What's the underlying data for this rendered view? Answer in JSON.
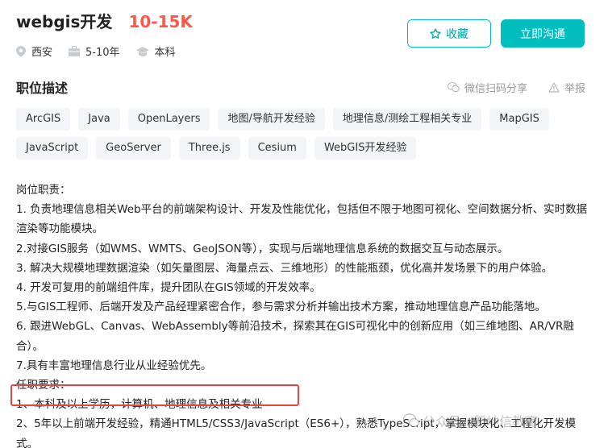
{
  "job": {
    "title": "webgis开发",
    "salary": "10-15K",
    "location": "西安",
    "experience": "5-10年",
    "degree": "本科"
  },
  "actions": {
    "collect_label": "收藏",
    "chat_label": "立即沟通"
  },
  "section": {
    "title": "职位描述",
    "share_label": "微信扫码分享",
    "report_label": "举报"
  },
  "tags": {
    "row1": [
      "ArcGIS",
      "Java",
      "OpenLayers",
      "地图/导航开发经验",
      "地理信息/测绘工程相关专业",
      "MapGIS"
    ],
    "row2": [
      "JavaScript",
      "GeoServer",
      "Three.js",
      "Cesium",
      "WebGIS开发经验"
    ]
  },
  "description": {
    "lines": [
      "岗位职责：",
      "1. 负责地理信息相关Web平台的前端架构设计、开发及性能优化，包括但不限于地图可视化、空间数据分析、实时数据渲染等功能模块。",
      "2.对接GIS服务（如WMS、WMTS、GeoJSON等），实现与后端地理信息系统的数据交互与动态展示。",
      "3. 解决大规模地理数据渲染（如矢量图层、海量点云、三维地形）的性能瓶颈，优化高并发场景下的用户体验。",
      "4. 开发可复用的前端组件库，提升团队在GIS领域的开发效率。",
      "5.与GIS工程师、后端开发及产品经理紧密合作，参与需求分析并输出技术方案，推动地理信息产品功能落地。",
      "6. 跟进WebGL、Canvas、WebAssembly等前沿技术，探索其在GIS可视化中的创新应用（如三维地图、AR/VR融合）。",
      "7.具有丰富地理信息行业从业经验优先。",
      "任职要求：",
      "1、本科及以上学历，计算机、地理信息及相关专业",
      "2、5年以上前端开发经验，精通HTML5/CSS3/JavaScript（ES6+），熟悉TypeScript，掌握模块化、工程化开发模式。"
    ]
  },
  "watermark": {
    "text": "公众号 · 新地信教育"
  },
  "colors": {
    "accent": "#00bebd",
    "salary": "#fe574a",
    "highlight": "#e64545"
  }
}
